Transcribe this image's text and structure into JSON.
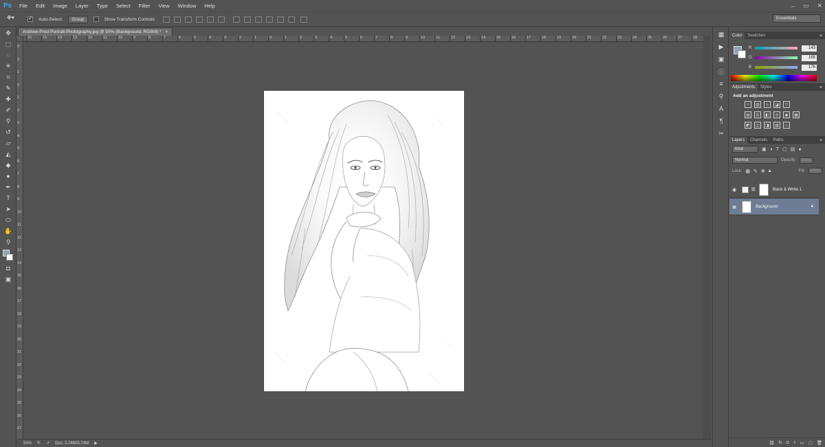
{
  "app": {
    "logo": "Ps",
    "menu": [
      "File",
      "Edit",
      "Image",
      "Layer",
      "Type",
      "Select",
      "Filter",
      "View",
      "Window",
      "Help"
    ]
  },
  "options": {
    "auto_select_label": "Auto-Select:",
    "auto_select_value": "Group",
    "show_transform_label": "Show Transform Controls",
    "workspace": "Essentials"
  },
  "document": {
    "tab_title": "Andrew-Prod-Portrait-Photography.jpg @ 50% (Background, RGB/8) *",
    "close_glyph": "×"
  },
  "rulers": {
    "h": [
      "16",
      "15",
      "14",
      "13",
      "12",
      "11",
      "10",
      "9",
      "8",
      "7",
      "6",
      "5",
      "4",
      "3",
      "2",
      "1",
      "0",
      "1",
      "2",
      "3",
      "4",
      "5",
      "6",
      "7",
      "8",
      "9",
      "10",
      "11",
      "12",
      "13",
      "14",
      "15",
      "16",
      "17",
      "18",
      "19",
      "20",
      "21",
      "22",
      "23",
      "24",
      "25",
      "26",
      "27",
      "28"
    ],
    "v": [
      "3",
      "2",
      "1",
      "0",
      "1",
      "2",
      "3",
      "4",
      "5",
      "6",
      "7",
      "8",
      "9",
      "10",
      "11",
      "12",
      "13",
      "14",
      "15",
      "16",
      "17",
      "18",
      "19",
      "20",
      "21",
      "22",
      "23",
      "24",
      "25",
      "26",
      "27"
    ]
  },
  "status": {
    "zoom": "50%",
    "doc": "Doc: 3.74M/3.74M"
  },
  "color_panel": {
    "tabs": [
      "Color",
      "Swatches"
    ],
    "r_label": "R",
    "r": "143",
    "g_label": "G",
    "g": "165",
    "b_label": "B",
    "b": "176",
    "fg_color": "#8fa5b0"
  },
  "adjustments_panel": {
    "tabs": [
      "Adjustments",
      "Styles"
    ],
    "title": "Add an adjustment"
  },
  "layers_panel": {
    "tabs": [
      "Layers",
      "Channels",
      "Paths"
    ],
    "kind": "Kind",
    "mode": "Normal",
    "opacity_label": "Opacity:",
    "opacity_value": "100%",
    "lock_label": "Lock:",
    "fill_label": "Fill:",
    "fill_value": "100%",
    "layers": [
      {
        "name": "Black & White 1"
      },
      {
        "name": "Background"
      }
    ]
  }
}
